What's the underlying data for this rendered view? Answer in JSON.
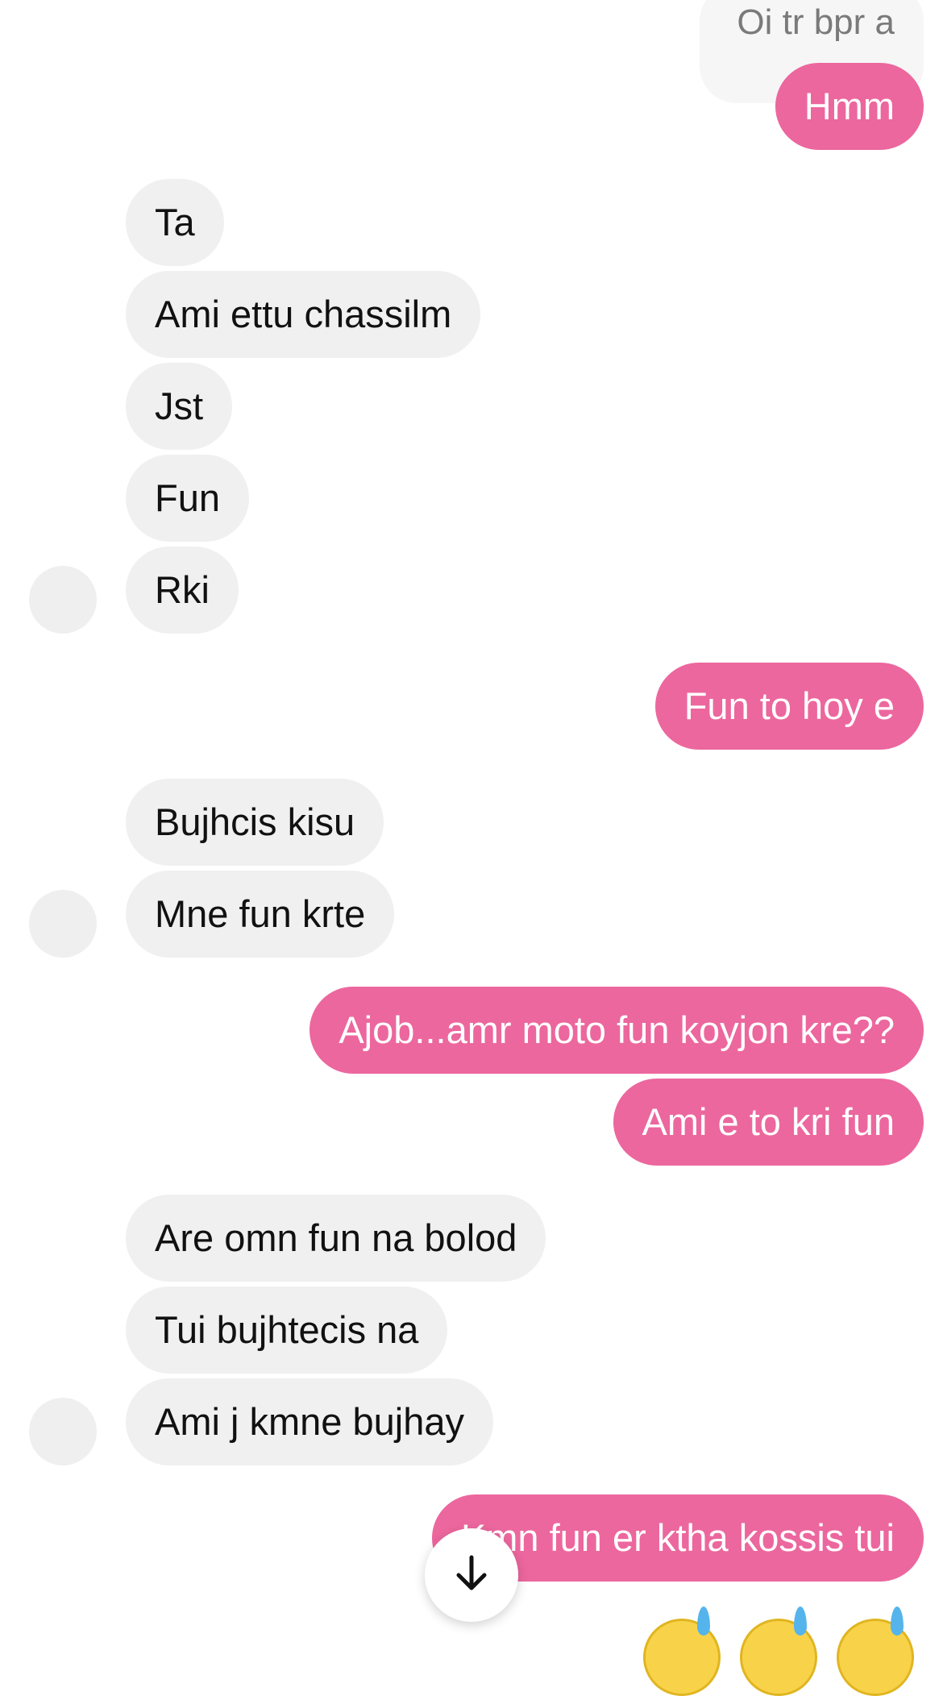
{
  "messages": {
    "quoted_reply": "Oi tr bpr a",
    "m1": "Hmm",
    "m2": "Ta",
    "m3": "Ami ettu chassilm",
    "m4": "Jst",
    "m5": "Fun",
    "m6": "Rki",
    "m7": "Fun to hoy e",
    "m8": "Bujhcis kisu",
    "m9": "Mne fun krte",
    "m10": "Ajob...amr moto fun koyjon kre??",
    "m11": "Ami e to kri fun",
    "m12": "Are omn fun na bolod",
    "m13": "Tui bujhtecis na",
    "m14": "Ami j kmne bujhay",
    "m15": "Kmn fun er ktha kossis tui"
  },
  "icons": {
    "scroll_down": "arrow-down-icon",
    "reaction": "sweat-smile-emoji"
  },
  "colors": {
    "outgoing_bubble": "#ec679e",
    "incoming_bubble": "#f0f0f0",
    "background": "#ffffff"
  }
}
